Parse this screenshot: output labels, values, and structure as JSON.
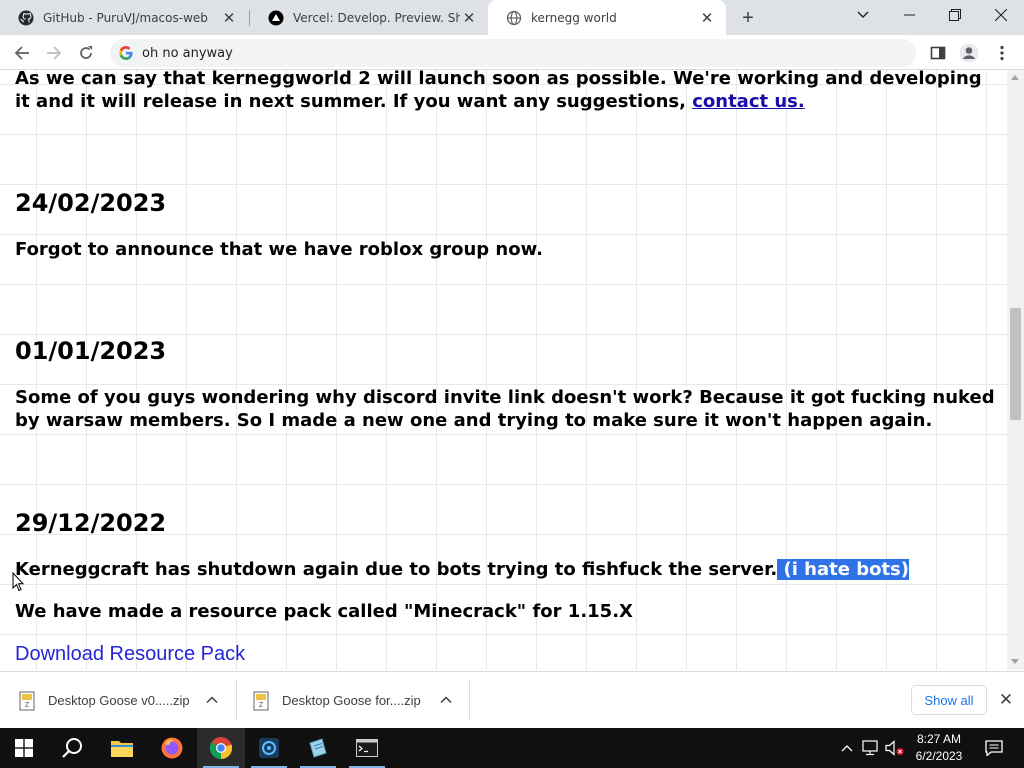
{
  "browser": {
    "tabs": [
      {
        "title": "GitHub - PuruVJ/macos-web",
        "favicon": "github-icon",
        "active": false
      },
      {
        "title": "Vercel: Develop. Preview. Ship. Fo",
        "favicon": "vercel-icon",
        "active": false
      },
      {
        "title": "kernegg world",
        "favicon": "globe-icon",
        "active": true
      }
    ],
    "omnibox_text": "oh no anyway"
  },
  "page": {
    "intro_text": "As we can say that kerneggworld 2 will launch soon as possible. We're working and developing it and it will release in next summer. If you want any suggestions, ",
    "intro_link": "contact us.",
    "posts": [
      {
        "date": "24/02/2023",
        "text": "Forgot to announce that we have roblox group now."
      },
      {
        "date": "01/01/2023",
        "text": "Some of you guys wondering why discord invite link doesn't work? Because it got fucking nuked by warsaw members. So I made a new one and trying to make sure it won't happen again."
      },
      {
        "date": "29/12/2022",
        "text": "Kerneggcraft has shutdown again due to bots trying to fishfuck the server.",
        "selected_text": " (i hate bots)",
        "text2": "We have made a resource pack called \"Minecrack\" for 1.15.X",
        "download_link": "Download Resource Pack"
      }
    ]
  },
  "downloads": {
    "items": [
      {
        "name": "Desktop Goose v0.....zip"
      },
      {
        "name": "Desktop Goose for....zip"
      }
    ],
    "show_all": "Show all"
  },
  "taskbar": {
    "time": "8:27 AM",
    "date": "6/2/2023",
    "apps": [
      "start-icon",
      "search-icon",
      "file-explorer-icon",
      "firefox-icon",
      "chrome-icon",
      "vscode-icon",
      "notepad-icon",
      "terminal-icon"
    ]
  },
  "colors": {
    "link": "#1a0dab",
    "selection": "#3073e8",
    "download_link": "#2525d8",
    "taskbar": "#101010"
  }
}
